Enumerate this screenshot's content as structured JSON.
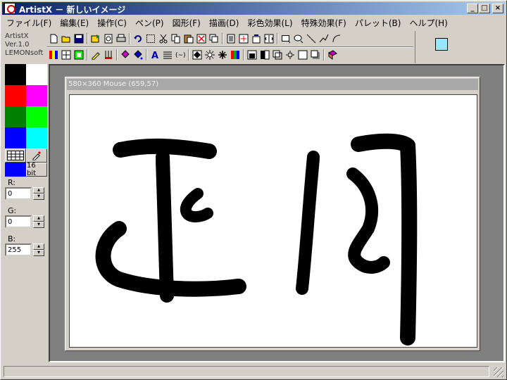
{
  "window": {
    "title": "ArtistX － 新しいイメージ"
  },
  "menu": [
    {
      "label": "ファイル(F)"
    },
    {
      "label": "編集(E)"
    },
    {
      "label": "操作(C)"
    },
    {
      "label": "ペン(P)"
    },
    {
      "label": "図形(F)"
    },
    {
      "label": "描画(D)"
    },
    {
      "label": "彩色効果(L)"
    },
    {
      "label": "特殊効果(F)"
    },
    {
      "label": "パレット(B)"
    },
    {
      "label": "ヘルプ(H)"
    }
  ],
  "app_info": {
    "name": "ArtistX",
    "version": "Ver.1.0",
    "author": "LEMONsoft"
  },
  "current_color": "#99e6ff",
  "palette": [
    "#000000",
    "#ffffff",
    "#ff0000",
    "#ff00ff",
    "#008000",
    "#00ff00",
    "#0000ff",
    "#00ffff"
  ],
  "palette_tools": {
    "bit_depth_label": "16 bit",
    "selected_color": "#0000ff"
  },
  "rgb": {
    "r_label": "R:",
    "r_value": "0",
    "g_label": "G:",
    "g_value": "0",
    "b_label": "B:",
    "b_value": "255"
  },
  "document": {
    "title": "580×360 Mouse (659,57)"
  }
}
